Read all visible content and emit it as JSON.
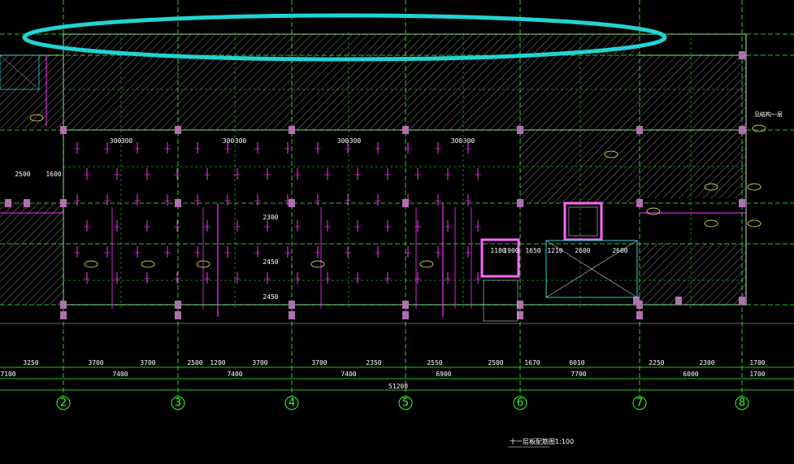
{
  "drawing": {
    "title": "十一层板配筋图",
    "scale": "1:100",
    "colors": {
      "background": "#000000",
      "grid": "#33ff33",
      "magenta": "#ff33ff",
      "white": "#ffffff",
      "cyan": "#22d3d3",
      "yellow": "#ffff66",
      "hatch": "#cccccc"
    }
  },
  "axes": [
    {
      "label": "2"
    },
    {
      "label": "3"
    },
    {
      "label": "4"
    },
    {
      "label": "5"
    },
    {
      "label": "6"
    },
    {
      "label": "7"
    },
    {
      "label": "8"
    }
  ],
  "dimensions_row1": [
    "3250",
    "3700",
    "3700",
    "2500",
    "1200",
    "3700",
    "3700",
    "2350",
    "2550",
    "2500",
    "1670",
    "6010",
    "2250",
    "2300",
    "1700"
  ],
  "dimensions_row2": [
    "7100",
    "7400",
    "7400",
    "7400",
    "6900",
    "7700",
    "6000",
    "1700"
  ],
  "total_dimension": "51200",
  "interior_dims": [
    "300",
    "300",
    "300",
    "300",
    "300",
    "300",
    "300",
    "300",
    "2500",
    "1600",
    "2450",
    "2450",
    "2300",
    "1180",
    "1900",
    "1650",
    "1210",
    "2600",
    "2600"
  ],
  "annotation": "见结构一层"
}
